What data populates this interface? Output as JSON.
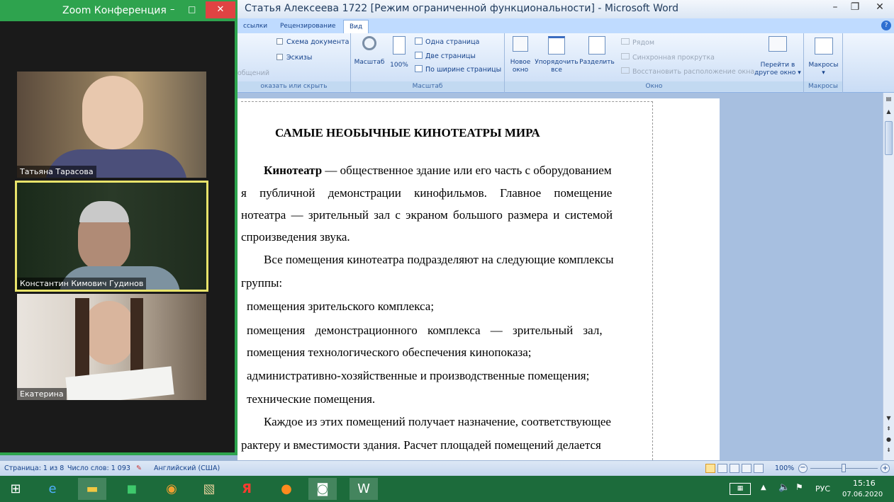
{
  "zoom": {
    "title": "Zoom Конференция",
    "participants": [
      {
        "name": "Татьяна Тарасова"
      },
      {
        "name": "Константин Кимович Гудинов"
      },
      {
        "name": "Екатерина"
      }
    ]
  },
  "word": {
    "title": "Статья Алексеева 1722 [Режим ограниченной функциональности] - Microsoft Word",
    "tabs": [
      "ссылки",
      "Рецензирование",
      "Вид"
    ],
    "ribbon": {
      "show_hide": {
        "doc_map": "Схема документа",
        "thumbnails": "Эскизы",
        "partial": "общений",
        "label": "оказать или скрыть"
      },
      "zoom": {
        "zoom": "Масштаб",
        "hundred": "100%",
        "one_page": "Одна страница",
        "two_pages": "Две страницы",
        "page_width": "По ширине страницы",
        "label": "Масштаб"
      },
      "window": {
        "new_window_1": "Новое",
        "new_window_2": "окно",
        "arrange_1": "Упорядочить",
        "arrange_2": "все",
        "split": "Разделить",
        "side_by_side": "Рядом",
        "sync_scroll": "Синхронная прокрутка",
        "reset_pos": "Восстановить расположение окна",
        "switch_1": "Перейти в",
        "switch_2": "другое окно",
        "label": "Окно"
      },
      "macros": {
        "macros": "Макросы",
        "label": "Макросы"
      }
    }
  },
  "document": {
    "heading": "САМЫЕ НЕОБЫЧНЫЕ КИНОТЕАТРЫ МИРА",
    "p1_bold": "Кинотеатр",
    "p1_l1": " — общественное здание или его часть с оборудованием",
    "p1_l2": "я публичной демонстрации кинофильмов. Главное помещение",
    "p1_l3": "нотеатра — зрительный зал с экраном большого размера и системой",
    "p1_l4": "спроизведения звука.",
    "p2_l1": "Все помещения кинотеатра подразделяют на следующие комплексы",
    "p2_l2": "группы:",
    "li1": "помещения зрительского комплекса;",
    "li2_l1": "помещения демонстрационного комплекса — зрительный зал,",
    "li2_l2": "помещения технологического обеспечения кинопоказа;",
    "li3": "административно-хозяйственные и производственные помещения;",
    "li4": "технические помещения.",
    "p3_l1": "Каждое из этих помещений получает назначение, соответствующее",
    "p3_l2": "рактеру и вместимости здания. Расчет площадей помещений делается"
  },
  "status": {
    "page": "Страница: 1 из 8",
    "words": "Число слов: 1 093",
    "lang": "Английский (США)",
    "zoom": "100%"
  },
  "taskbar": {
    "lang": "РУС",
    "time": "15:16",
    "date": "07.06.2020"
  }
}
